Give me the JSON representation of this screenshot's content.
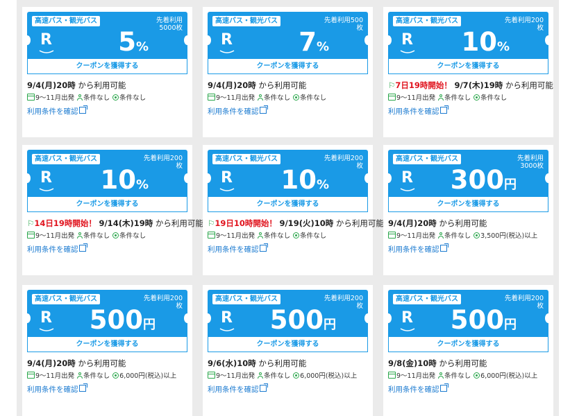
{
  "coupons": [
    {
      "category": "高速バス・観光バス",
      "limit": "先着利用5000枚",
      "value": "5",
      "unit": "%",
      "get_label": "クーポンを獲得する",
      "notice": "",
      "date": "9/4(月)20時",
      "avail_suffix": " から利用可能",
      "period": "9～11月出発",
      "cond1": "条件なし",
      "cond2": "条件なし",
      "terms": "利用条件を確認"
    },
    {
      "category": "高速バス・観光バス",
      "limit": "先着利用500枚",
      "value": "7",
      "unit": "%",
      "get_label": "クーポンを獲得する",
      "notice": "",
      "date": "9/4(月)20時",
      "avail_suffix": " から利用可能",
      "period": "9～11月出発",
      "cond1": "条件なし",
      "cond2": "条件なし",
      "terms": "利用条件を確認"
    },
    {
      "category": "高速バス・観光バス",
      "limit": "先着利用200枚",
      "value": "10",
      "unit": "%",
      "get_label": "クーポンを獲得する",
      "notice": "7日19時開始！",
      "date": "9/7(木)19時",
      "avail_suffix": " から利用可能",
      "period": "9～11月出発",
      "cond1": "条件なし",
      "cond2": "条件なし",
      "terms": "利用条件を確認"
    },
    {
      "category": "高速バス・観光バス",
      "limit": "先着利用200枚",
      "value": "10",
      "unit": "%",
      "get_label": "クーポンを獲得する",
      "notice": "14日19時開始！",
      "date": "9/14(木)19時",
      "avail_suffix": " から利用可能",
      "period": "9～11月出発",
      "cond1": "条件なし",
      "cond2": "条件なし",
      "terms": "利用条件を確認"
    },
    {
      "category": "高速バス・観光バス",
      "limit": "先着利用200枚",
      "value": "10",
      "unit": "%",
      "get_label": "クーポンを獲得する",
      "notice": "19日10時開始！",
      "date": "9/19(火)10時",
      "avail_suffix": " から利用可能",
      "period": "9～11月出発",
      "cond1": "条件なし",
      "cond2": "条件なし",
      "terms": "利用条件を確認"
    },
    {
      "category": "高速バス・観光バス",
      "limit": "先着利用3000枚",
      "value": "300",
      "unit": "円",
      "get_label": "クーポンを獲得する",
      "notice": "",
      "date": "9/4(月)20時",
      "avail_suffix": " から利用可能",
      "period": "9～11月出発",
      "cond1": "条件なし",
      "cond2": "3,500円(税込)以上",
      "terms": "利用条件を確認"
    },
    {
      "category": "高速バス・観光バス",
      "limit": "先着利用200枚",
      "value": "500",
      "unit": "円",
      "get_label": "クーポンを獲得する",
      "notice": "",
      "date": "9/4(月)20時",
      "avail_suffix": " から利用可能",
      "period": "9～11月出発",
      "cond1": "条件なし",
      "cond2": "6,000円(税込)以上",
      "terms": "利用条件を確認"
    },
    {
      "category": "高速バス・観光バス",
      "limit": "先着利用200枚",
      "value": "500",
      "unit": "円",
      "get_label": "クーポンを獲得する",
      "notice": "",
      "date": "9/6(水)10時",
      "avail_suffix": " から利用可能",
      "period": "9～11月出発",
      "cond1": "条件なし",
      "cond2": "6,000円(税込)以上",
      "terms": "利用条件を確認"
    },
    {
      "category": "高速バス・観光バス",
      "limit": "先着利用200枚",
      "value": "500",
      "unit": "円",
      "get_label": "クーポンを獲得する",
      "notice": "",
      "date": "9/8(金)10時",
      "avail_suffix": " から利用可能",
      "period": "9～11月出発",
      "cond1": "条件なし",
      "cond2": "6,000円(税込)以上",
      "terms": "利用条件を確認"
    }
  ],
  "colors": {
    "ticket_blue": "#1a9ae6",
    "notice_red": "#e0141e",
    "icon_green": "#2aa64b",
    "link_blue": "#1a7ad0"
  },
  "icons": {
    "logo": "rakuten-r-logo",
    "calendar": "calendar-icon",
    "person": "person-icon",
    "condition": "circle-check-icon",
    "external": "external-link-icon",
    "flag": "flag-icon"
  }
}
